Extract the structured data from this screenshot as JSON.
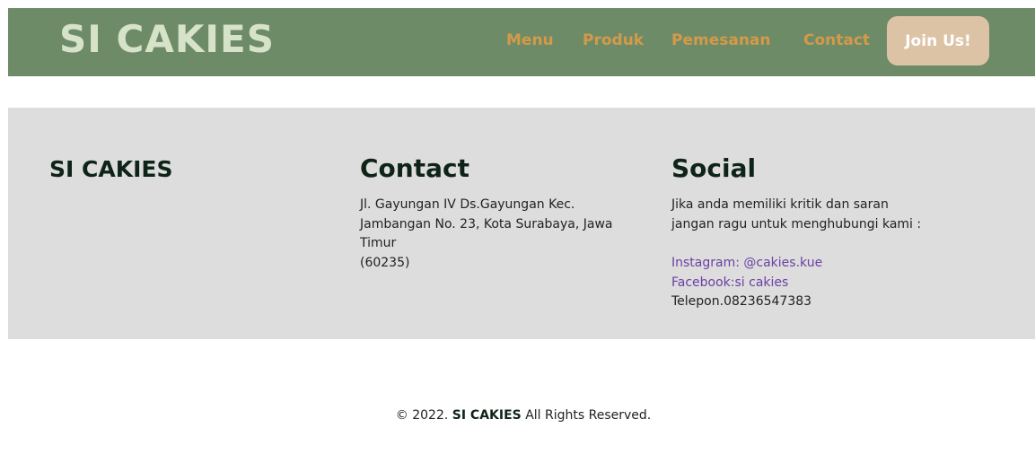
{
  "header": {
    "brand": "SI CAKIES",
    "nav": {
      "menu": "Menu",
      "produk": "Produk",
      "pemesanan": "Pemesanan",
      "contact": "Contact"
    },
    "join_label": "Join Us!"
  },
  "footer": {
    "brand": "SI CAKIES",
    "contact": {
      "heading": "Contact",
      "line1": "Jl. Gayungan IV Ds.Gayungan Kec.",
      "line2": "Jambangan No. 23, Kota Surabaya, Jawa",
      "line3": "Timur",
      "line4": "(60235)"
    },
    "social": {
      "heading": "Social",
      "line1": "Jika anda memiliki kritik dan saran",
      "line2": "jangan ragu untuk menghubungi kami :",
      "instagram": "Instagram: @cakies.kue",
      "facebook": "Facebook:si cakies",
      "phone": "Telepon.08236547383"
    }
  },
  "copyright": {
    "prefix": "© 2022.",
    "brand": "SI CAKIES",
    "suffix": "All Rights Reserved."
  },
  "colors": {
    "navbar": "#6e8b68",
    "nav_link": "#d39a48",
    "join_button": "#ddc3a6",
    "footer_band": "#dddddd",
    "heading": "#0f2418",
    "social_link": "#6b3fa3"
  }
}
